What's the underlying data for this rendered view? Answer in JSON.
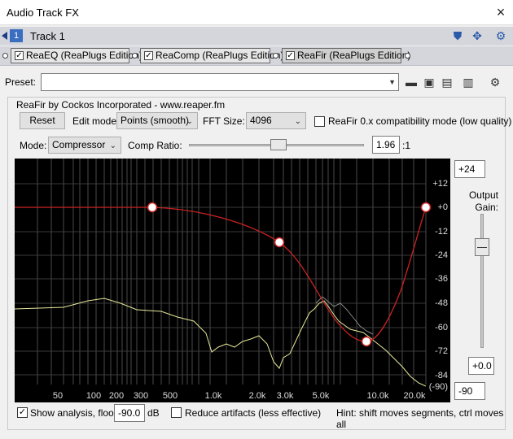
{
  "window": {
    "title": "Audio Track FX",
    "close_label": "×"
  },
  "track": {
    "number": "1",
    "name": "Track 1"
  },
  "fx_chain": [
    {
      "label": "ReaEQ (ReaPlugs Edition)",
      "checked": true
    },
    {
      "label": "ReaComp (ReaPlugs Edition)",
      "checked": true
    },
    {
      "label": "ReaFir (ReaPlugs Edition)",
      "checked": true
    }
  ],
  "preset": {
    "label": "Preset:",
    "value": ""
  },
  "plugin": {
    "title": "ReaFir by Cockos Incorporated - www.reaper.fm",
    "reset_label": "Reset",
    "edit_mode_label": "Edit mode:",
    "edit_mode_value": "Points (smooth)",
    "fft_size_label": "FFT Size:",
    "fft_size_value": "4096",
    "compat_label": "ReaFir 0.x compatibility mode (low quality)",
    "compat_checked": false,
    "mode_label": "Mode:",
    "mode_value": "Compressor",
    "comp_ratio_label": "Comp Ratio:",
    "comp_ratio_value": "1.96",
    "comp_ratio_suffix": ":1",
    "top_db_value": "+24",
    "bottom_db_value": "-90",
    "output_gain_label": "Output Gain:",
    "output_gain_value": "+0.0",
    "show_analysis_label": "Show analysis, floor:",
    "show_analysis_checked": true,
    "floor_value": "-90.0",
    "floor_unit": "dB",
    "reduce_artifacts_label": "Reduce artifacts (less effective)",
    "reduce_artifacts_checked": false,
    "hint": "Hint: shift moves segments, ctrl moves all"
  },
  "graph": {
    "freq_labels": [
      "50",
      "100",
      "200",
      "300",
      "500",
      "1.0k",
      "2.0k",
      "3.0k",
      "5.0k",
      "10.0k",
      "20.0k"
    ],
    "db_labels": [
      "+12",
      "+0",
      "-12",
      "-24",
      "-36",
      "-48",
      "-60",
      "-72",
      "-84",
      "(-90)"
    ],
    "curve_color": "#cc2222",
    "analysis_color": "#e8e89a"
  }
}
